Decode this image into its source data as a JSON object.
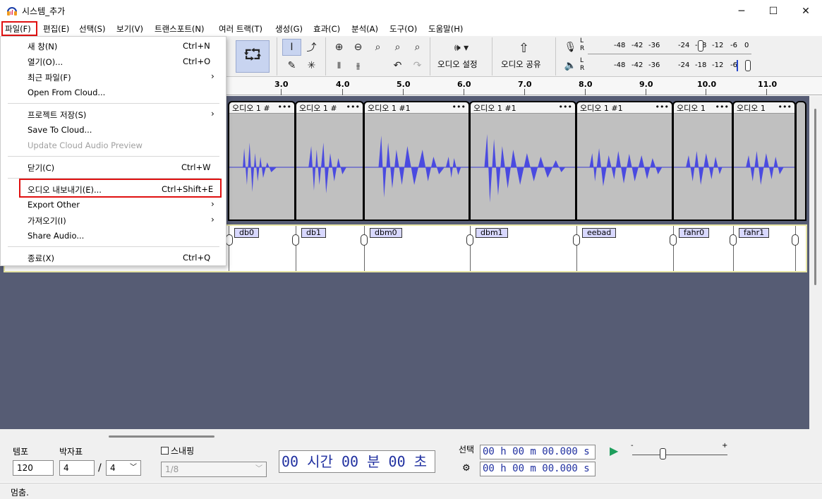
{
  "window": {
    "title": "시스템_추가",
    "minimize": "─",
    "maximize": "☐",
    "close": "✕"
  },
  "menu": [
    "파일(F)",
    "편집(E)",
    "선택(S)",
    "보기(V)",
    "트랜스포트(N)",
    "여러 트랙(T)",
    "생성(G)",
    "효과(C)",
    "분석(A)",
    "도구(O)",
    "도움말(H)"
  ],
  "file_menu": {
    "items": [
      {
        "label": "새 창(N)",
        "shortcut": "Ctrl+N"
      },
      {
        "label": "열기(O)...",
        "shortcut": "Ctrl+O"
      },
      {
        "label": "최근 파일(F)",
        "submenu": true
      },
      {
        "label": "Open From Cloud..."
      },
      {
        "label": "프로젝트 저장(S)",
        "submenu": true
      },
      {
        "label": "Save To Cloud..."
      },
      {
        "label": "Update Cloud Audio Preview",
        "disabled": true
      },
      {
        "label": "닫기(C)",
        "shortcut": "Ctrl+W"
      },
      {
        "label": "오디오 내보내기(E)...",
        "shortcut": "Ctrl+Shift+E"
      },
      {
        "label": "Export Other",
        "submenu": true
      },
      {
        "label": "가져오기(I)",
        "submenu": true
      },
      {
        "label": "Share Audio..."
      },
      {
        "label": "종료(X)",
        "shortcut": "Ctrl+Q"
      }
    ]
  },
  "toolbar": {
    "audio_setup": "오디오 설정",
    "share_audio": "오디오 공유",
    "meter_ticks": [
      "-48",
      "-42",
      "-36",
      "-24",
      "-18",
      "-12",
      "-6",
      "0"
    ],
    "meter_l": "L",
    "meter_r": "R"
  },
  "ruler": [
    "3.0",
    "4.0",
    "5.0",
    "6.0",
    "7.0",
    "8.0",
    "9.0",
    "10.0",
    "11.0"
  ],
  "clips": [
    "오디오 1 #",
    "오디오 1 #",
    "오디오 1 #1",
    "오디오 1 #1",
    "오디오 1 #1",
    "오디오 1",
    "오디오 1"
  ],
  "clip_dots": "•••",
  "labels": [
    "db0",
    "db1",
    "dbm0",
    "dbm1",
    "eebad",
    "fahr0",
    "fahr1"
  ],
  "bottom": {
    "tempo_label": "템포",
    "tempo_value": "120",
    "timesig_label": "박자표",
    "timesig_num": "4",
    "timesig_slash": "/",
    "timesig_den": "4",
    "snap_label": "스내핑",
    "snap_value": "1/8",
    "time_display": "00 시간 00 분 00 초",
    "selection_label": "선택",
    "sel_start": "00 h 00 m 00.000 s",
    "sel_end": "00 h 00 m 00.000 s",
    "speed_minus": "-",
    "speed_plus": "+"
  },
  "status": "멈춤."
}
